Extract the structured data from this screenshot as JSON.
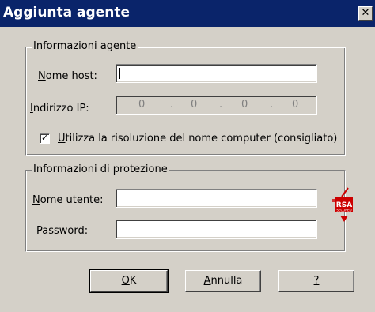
{
  "window": {
    "title": "Aggiunta agente",
    "close_glyph": "✕"
  },
  "agent_info": {
    "legend": "Informazioni agente",
    "host_label_u": "N",
    "host_label_rest": "ome host:",
    "host_value": "",
    "ip_label_u": "I",
    "ip_label_rest": "ndirizzo IP:",
    "ip_octets": [
      "0",
      "0",
      "0",
      "0"
    ],
    "ip_dot": ".",
    "checkbox_checked": true,
    "checkbox_label_u": "U",
    "checkbox_label_rest": "tilizza la risoluzione del nome computer (consigliato)"
  },
  "security_info": {
    "legend": "Informazioni di protezione",
    "user_label_u": "N",
    "user_label_rest": "ome utente:",
    "user_value": "",
    "password_label_u": "P",
    "password_label_rest": "assword:",
    "password_value": "",
    "logo_text": "RSA",
    "logo_subtext": "SECURED",
    "logo_icon": "rsa-secured-icon"
  },
  "buttons": {
    "ok_u": "O",
    "ok_rest": "K",
    "cancel_u": "A",
    "cancel_rest": "nnulla",
    "help_u": "?",
    "help_rest": ""
  },
  "colors": {
    "title_bar": "#0a246a",
    "dialog_bg": "#d4d0c8",
    "logo_red": "#cc0000"
  }
}
